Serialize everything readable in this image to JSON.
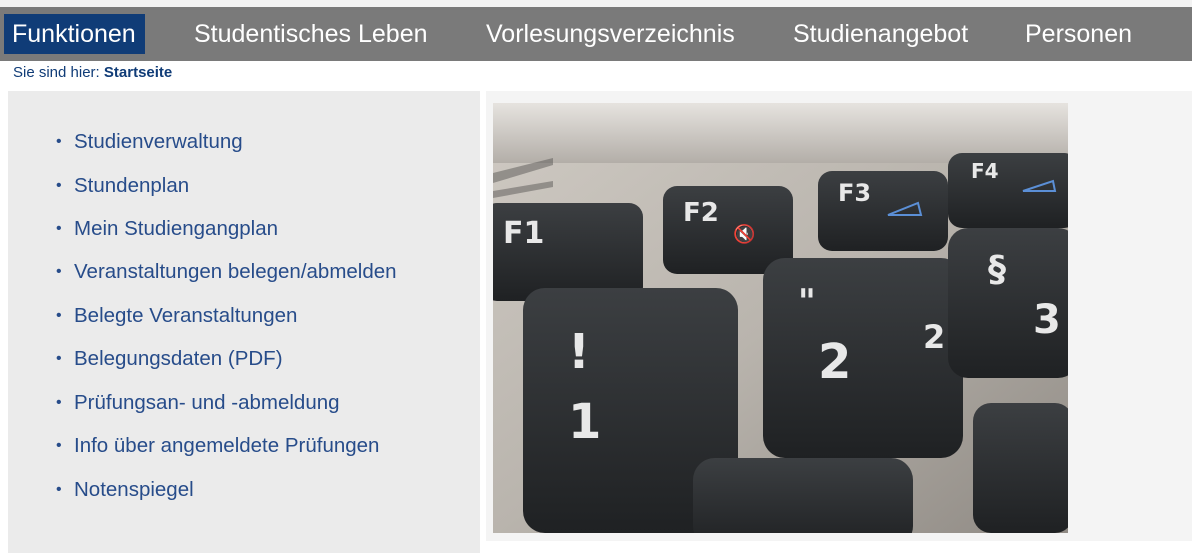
{
  "nav": {
    "items": [
      {
        "label": "Funktionen",
        "active": true
      },
      {
        "label": "Studentisches Leben",
        "active": false
      },
      {
        "label": "Vorlesungsverzeichnis",
        "active": false
      },
      {
        "label": "Studienangebot",
        "active": false
      },
      {
        "label": "Personen",
        "active": false
      }
    ]
  },
  "breadcrumb": {
    "prefix": "Sie sind hier:",
    "current": "Startseite"
  },
  "menu": {
    "items": [
      {
        "label": "Studienverwaltung"
      },
      {
        "label": "Stundenplan"
      },
      {
        "label": "Mein Studiengangplan"
      },
      {
        "label": "Veranstaltungen belegen/abmelden"
      },
      {
        "label": "Belegte Veranstaltungen"
      },
      {
        "label": "Belegungsdaten (PDF)"
      },
      {
        "label": "Prüfungsan- und -abmeldung"
      },
      {
        "label": "Info über angemeldete Prüfungen"
      },
      {
        "label": "Notenspiegel"
      }
    ]
  },
  "photo": {
    "keys": [
      "F1",
      "F2",
      "F3",
      "F4",
      "!",
      "1",
      "\"",
      "2",
      "2",
      "§",
      "3"
    ]
  },
  "colors": {
    "nav_bg": "#7a7a7a",
    "nav_active_bg": "#103c77",
    "link": "#274c8a",
    "panel_bg": "#ebebeb"
  }
}
